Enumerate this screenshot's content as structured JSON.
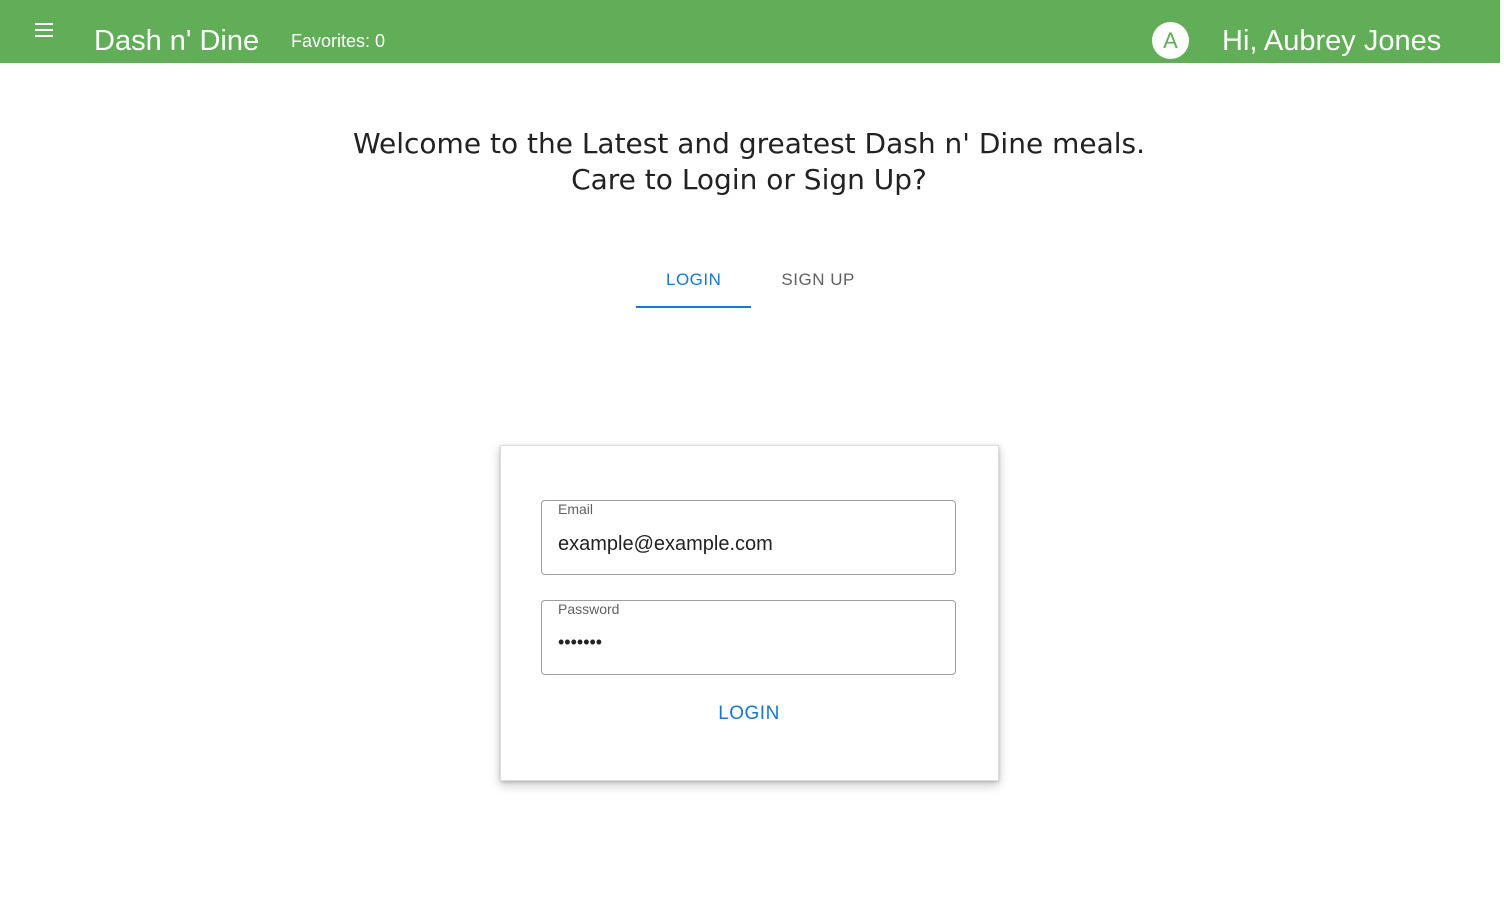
{
  "header": {
    "menu_icon": "menu-icon",
    "app_title": "Dash n' Dine",
    "favorites": "Favorites: 0",
    "avatar_initial": "A",
    "greeting": "Hi, Aubrey Jones"
  },
  "welcome": {
    "line1": "Welcome to the Latest and greatest Dash n' Dine meals.",
    "line2": "Care to Login or Sign Up?"
  },
  "tabs": [
    {
      "label": "LOGIN",
      "active": true
    },
    {
      "label": "SIGN UP",
      "active": false
    }
  ],
  "login_form": {
    "email_label": "Email",
    "email_value": "example@example.com",
    "password_label": "Password",
    "password_value": "•••••••",
    "submit_label": "LOGIN"
  },
  "colors": {
    "appbar": "#61ad58",
    "accent": "#1976d2"
  }
}
